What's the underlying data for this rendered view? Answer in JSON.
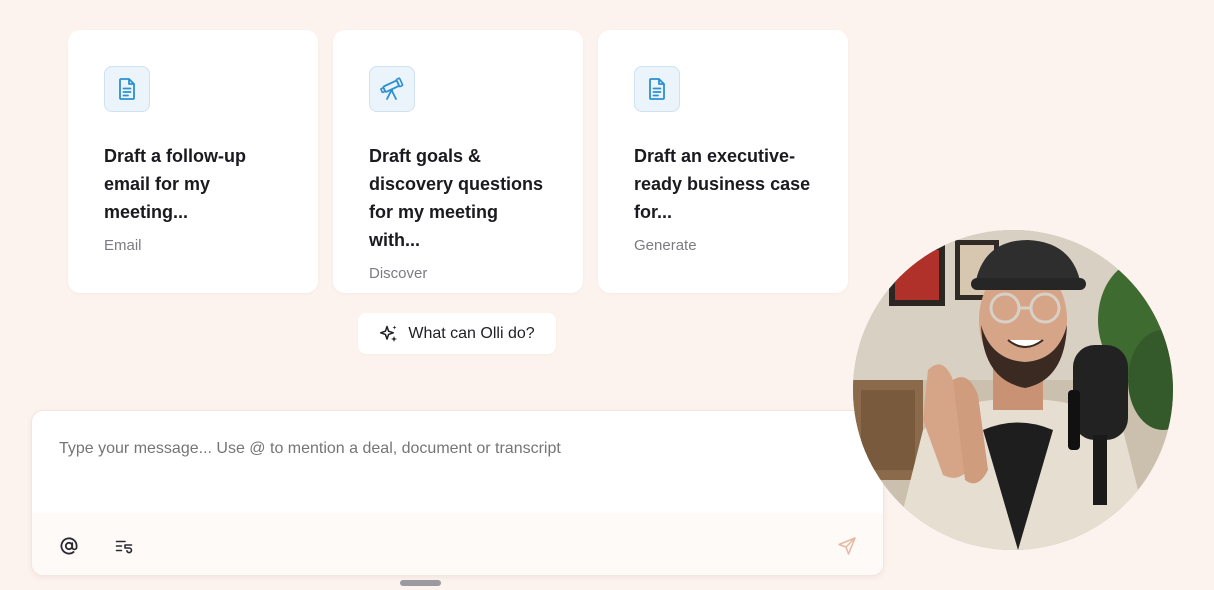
{
  "cards": [
    {
      "title": "Draft a follow-up email for my meeting...",
      "category": "Email",
      "icon": "document-icon"
    },
    {
      "title": "Draft goals & discovery questions for my meeting with...",
      "category": "Discover",
      "icon": "telescope-icon"
    },
    {
      "title": "Draft an executive-ready business case for...",
      "category": "Generate",
      "icon": "document-icon"
    }
  ],
  "olli_button": {
    "label": "What can Olli do?",
    "icon": "sparkle-icon"
  },
  "composer": {
    "placeholder": "Type your message... Use @ to mention a deal, document or transcript",
    "tools": [
      "mention-icon",
      "prompt-list-icon"
    ],
    "send_icon": "send-icon"
  },
  "colors": {
    "background": "#fdf3ee",
    "card": "#ffffff",
    "icon_accent": "#2b8fd1",
    "icon_bg": "#ebf4fb"
  }
}
